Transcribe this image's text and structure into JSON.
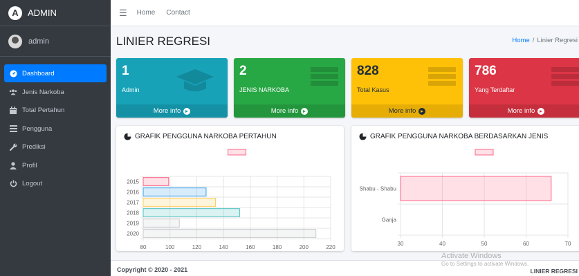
{
  "brand": {
    "title": "ADMIN",
    "logo_letter": "A"
  },
  "user": {
    "name": "admin"
  },
  "sidebar": {
    "items": [
      {
        "label": "Dashboard",
        "icon": "tachometer-icon",
        "active": true
      },
      {
        "label": "Jenis Narkoba",
        "icon": "users-icon"
      },
      {
        "label": "Total Pertahun",
        "icon": "calendar-icon"
      },
      {
        "label": "Pengguna",
        "icon": "list-icon"
      },
      {
        "label": "Prediksi",
        "icon": "wrench-icon"
      },
      {
        "label": "Profil",
        "icon": "user-icon"
      },
      {
        "label": "Logout",
        "icon": "power-icon"
      }
    ]
  },
  "topnav": {
    "home": "Home",
    "contact": "Contact"
  },
  "page": {
    "title": "LINIER REGRESI"
  },
  "breadcrumb": {
    "home": "Home",
    "current": "Linier Regresi"
  },
  "boxes": [
    {
      "value": "1",
      "label": "Admin",
      "more": "More info",
      "color": "#17a2b8"
    },
    {
      "value": "2",
      "label": "JENIS NARKOBA",
      "more": "More info",
      "color": "#28a745"
    },
    {
      "value": "828",
      "label": "Total Kasus",
      "more": "More info",
      "color": "#ffc107"
    },
    {
      "value": "786",
      "label": "Yang Terdaftar",
      "more": "More info",
      "color": "#dc3545"
    }
  ],
  "cards": {
    "left_title": "GRAFIK PENGGUNA NARKOBA PERTAHUN",
    "right_title": "GRAFIK PENGGUNA NARKOBA BERDASARKAN JENIS"
  },
  "chart_data": [
    {
      "type": "bar",
      "orientation": "horizontal",
      "title": "",
      "categories": [
        "2015",
        "2016",
        "2017",
        "2018",
        "2019",
        "2020"
      ],
      "values": [
        99,
        127,
        134,
        152,
        107,
        209
      ],
      "xlim": [
        80,
        220
      ],
      "xticks": [
        80,
        100,
        120,
        140,
        160,
        180,
        200,
        220
      ],
      "colors": [
        "#ff6384",
        "#36a2eb",
        "#ffce56",
        "#4bc0c0",
        "#c9cbcf",
        "#c9cbcf"
      ],
      "legend": "top",
      "grid": true
    },
    {
      "type": "bar",
      "orientation": "horizontal",
      "title": "",
      "categories": [
        "Shabu - Shabu",
        "Ganja"
      ],
      "values": [
        66,
        0
      ],
      "xlim": [
        30,
        70
      ],
      "xticks": [
        30,
        40,
        50,
        60,
        70
      ],
      "colors": [
        "#ff6384",
        "#ff6384"
      ],
      "legend": "top",
      "grid": true
    }
  ],
  "footer": {
    "copyright": "Copyright © 2020 - 2021",
    "right": "LINIER REGRESI"
  },
  "watermark": {
    "line1": "Activate Windows",
    "line2": "Go to Settings to activate Windows."
  }
}
